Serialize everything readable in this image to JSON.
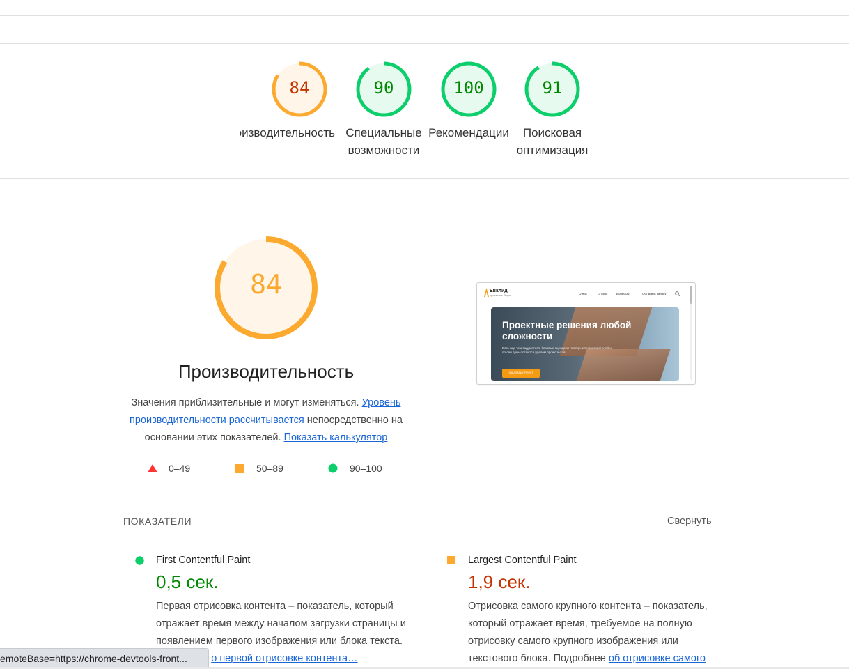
{
  "categories": [
    {
      "score": "84",
      "label": "Производительность",
      "level": "average",
      "fraction": 0.84
    },
    {
      "score": "90",
      "label": "Специальные возможности",
      "level": "pass",
      "fraction": 0.9
    },
    {
      "score": "100",
      "label": "Рекомендации",
      "level": "pass",
      "fraction": 1.0
    },
    {
      "score": "91",
      "label": "Поисковая оптимизация",
      "level": "pass",
      "fraction": 0.91
    }
  ],
  "colors": {
    "average": "#fca930",
    "average_text": "#c33300",
    "average_bg": "#fff6e9",
    "pass": "#0cce6b",
    "pass_text": "#008800",
    "pass_bg": "#e6faef",
    "fail": "#ff3333",
    "link": "#1a66d6"
  },
  "performance": {
    "score": "84",
    "fraction": 0.84,
    "title": "Производительность",
    "desc_text1": "Значения приблизительные и могут изменяться. ",
    "desc_link1": "Уровень производительности рассчитывается",
    "desc_text2": " непосредственно на основании этих показателей. ",
    "desc_link2": "Показать калькулятор"
  },
  "legend": [
    {
      "shape": "triangle-icon",
      "range": "0–49"
    },
    {
      "shape": "square-icon",
      "range": "50–89"
    },
    {
      "shape": "circle-icon",
      "range": "90–100"
    }
  ],
  "screenshot": {
    "logo": "Евклид",
    "logo_sub": "проектное бюро",
    "nav": [
      "О нас",
      "Этапы",
      "Вопросы",
      "Оставить заявку"
    ],
    "hero_title": "Проектные решения любой сложности",
    "hero_text": "Есть над чем задуматься: базовые сценарии поведения пользователей и по сей день остаются уделом проектантов",
    "cta": "ЗАКАЗАТЬ ПРОЕКТ"
  },
  "metrics": {
    "header": "ПОКАЗАТЕЛИ",
    "collapse": "Свернуть",
    "items": [
      {
        "name": "First Contentful Paint",
        "value": "0,5 сек.",
        "level": "pass",
        "desc": "Первая отрисовка контента – показатель, который отражает время между началом загрузки страницы и появлением первого изображения или блока текста. Подробнее ",
        "link": "о первой отрисовке контента…"
      },
      {
        "name": "Largest Contentful Paint",
        "value": "1,9 сек.",
        "level": "average",
        "desc": "Отрисовка самого крупного контента – показатель, который отражает время, требуемое на полную отрисовку самого крупного изображения или текстового блока. Подробнее ",
        "link": "об отрисовке самого"
      }
    ]
  },
  "status_bar": "emoteBase=https://chrome-devtools-front..."
}
